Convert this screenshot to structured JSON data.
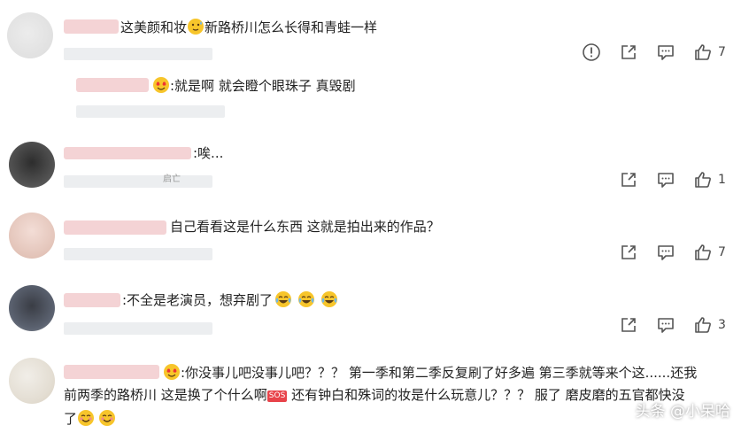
{
  "comments": [
    {
      "text": "这美颜和妆",
      "text_after": "新路桥川怎么长得和青蛙一样",
      "likes": "7",
      "reply": {
        "text": ":就是啊 就会瞪个眼珠子 真毁剧"
      }
    },
    {
      "text": ":唉...",
      "meta_text": "启亡",
      "likes": "1"
    },
    {
      "text": "自己看看这是什么东西 这就是拍出来的作品？",
      "likes": "7"
    },
    {
      "text": ":不全是老演员，想弃剧了",
      "likes": "3"
    },
    {
      "line1": ":你没事儿吧没事儿吧？？？ 第一季和第二季反复刷了好多遍 第三季就等来个这......还我",
      "line2a": "前两季的路桥川 这是换了个什么啊",
      "sos": "SOS",
      "line2b": " 还有钟白和殊词的妆是什么玩意儿？？？ 服了 磨皮磨的五官都快没",
      "line3": "了"
    }
  ],
  "watermark": "头条 @小呆哈",
  "icons": [
    "report-icon",
    "share-icon",
    "comment-icon",
    "like-icon"
  ],
  "colors": {
    "icon": "#555555",
    "text": "#222222",
    "blur": "#f2c9cc"
  }
}
